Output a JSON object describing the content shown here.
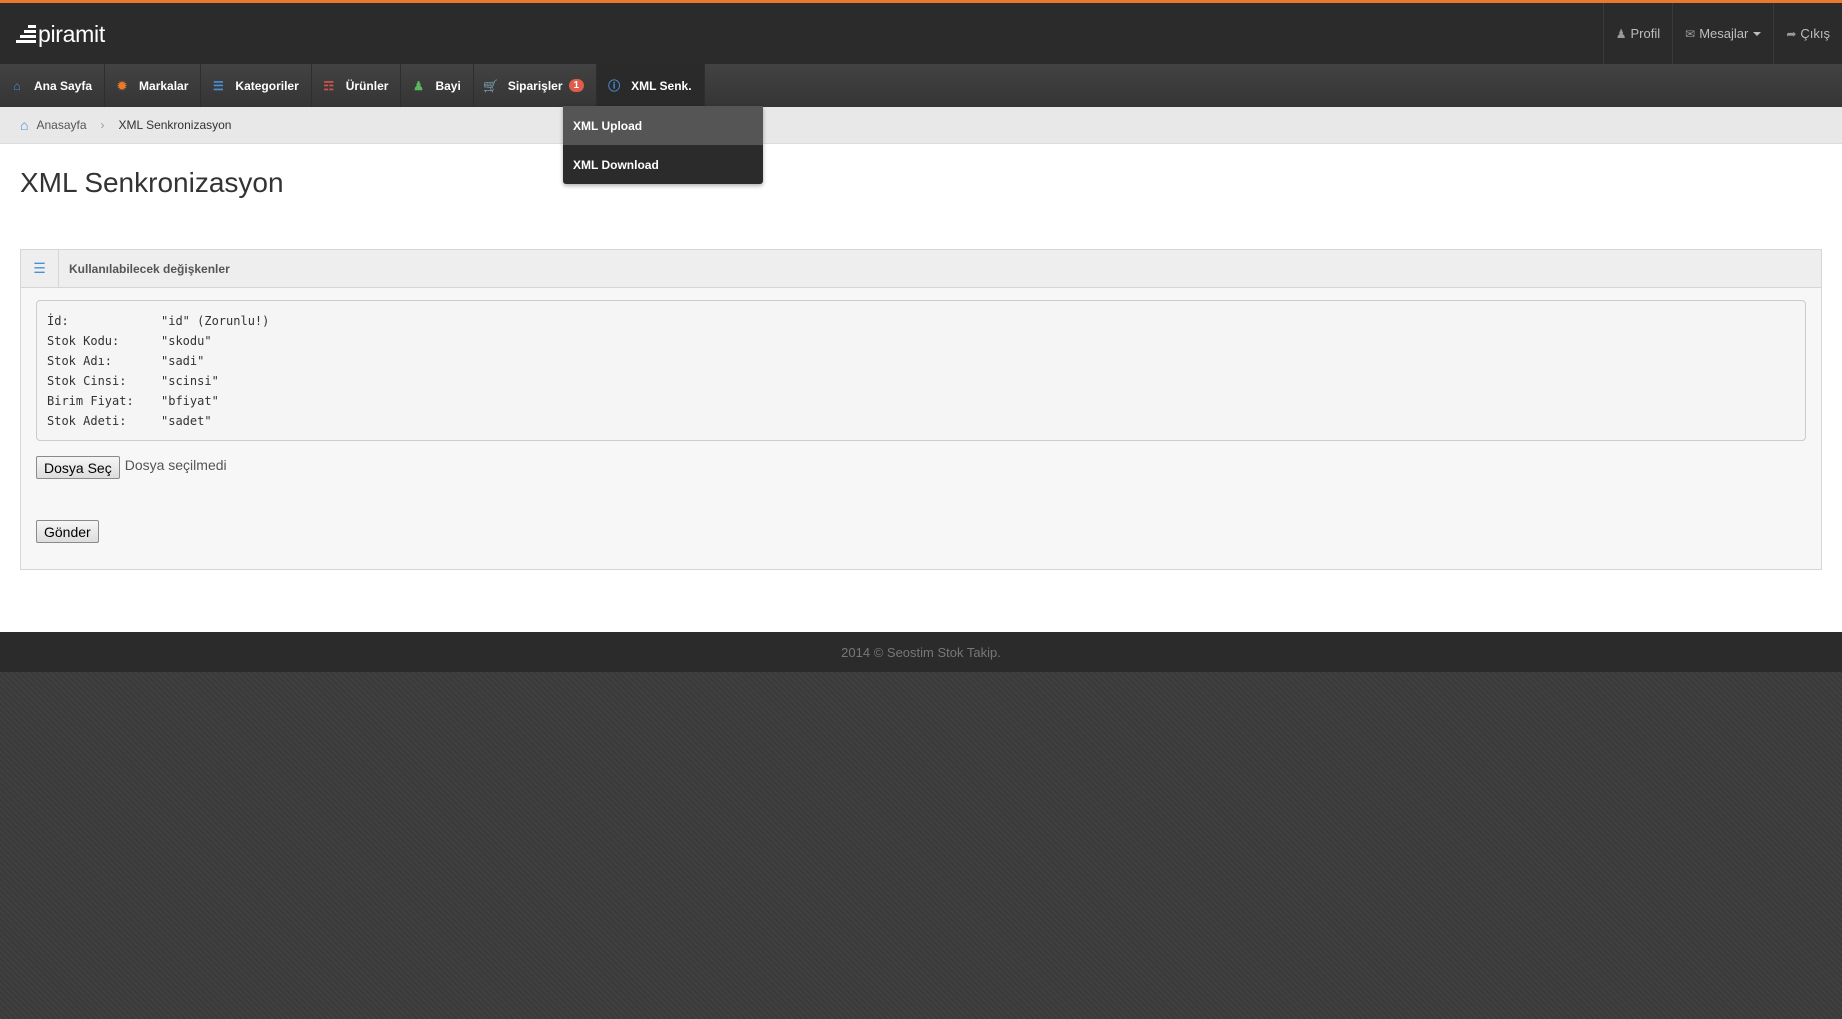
{
  "header": {
    "logo_text": "piramit",
    "links": [
      {
        "icon": "user-icon",
        "label": "Profil"
      },
      {
        "icon": "envelope-icon",
        "label": "Mesajlar"
      },
      {
        "icon": "share-icon",
        "label": "Çıkış"
      }
    ]
  },
  "nav": {
    "items": [
      {
        "icon": "home-icon",
        "label": "Ana Sayfa",
        "color": "#4a90d9"
      },
      {
        "icon": "sun-icon",
        "label": "Markalar",
        "color": "#e9792c"
      },
      {
        "icon": "list-icon",
        "label": "Kategoriler",
        "color": "#4a90d9"
      },
      {
        "icon": "columns-icon",
        "label": "Ürünler",
        "color": "#d9534f"
      },
      {
        "icon": "user-icon",
        "label": "Bayi",
        "color": "#5cb85c"
      },
      {
        "icon": "cart-icon",
        "label": "Siparişler",
        "color": "#4a90d9",
        "badge": "1"
      },
      {
        "icon": "info-icon",
        "label": "XML Senk.",
        "color": "#4a90d9",
        "active": true
      }
    ],
    "dropdown": [
      "XML Upload",
      "XML Download"
    ]
  },
  "breadcrumb": {
    "home": "Anasayfa",
    "current": "XML Senkronizasyon"
  },
  "page": {
    "title": "XML Senkronizasyon",
    "panel_title": "Kullanılabilecek değişkenler",
    "variables": [
      {
        "key": "İd:",
        "value": "\"id\" (Zorunlu!)"
      },
      {
        "key": "Stok Kodu:",
        "value": "\"skodu\""
      },
      {
        "key": "Stok Adı:",
        "value": "\"sadi\""
      },
      {
        "key": "Stok Cinsi:",
        "value": "\"scinsi\""
      },
      {
        "key": "Birim Fiyat:",
        "value": "\"bfiyat\""
      },
      {
        "key": "Stok Adeti:",
        "value": "\"sadet\""
      }
    ],
    "file_button": "Dosya Seç",
    "file_status": "Dosya seçilmedi",
    "submit": "Gönder"
  },
  "footer": {
    "text": "2014 © Seostim Stok Takip."
  },
  "colors": {
    "accent": "#e9792c",
    "topbar": "#2b2b2b",
    "badge": "#e05c4b"
  }
}
